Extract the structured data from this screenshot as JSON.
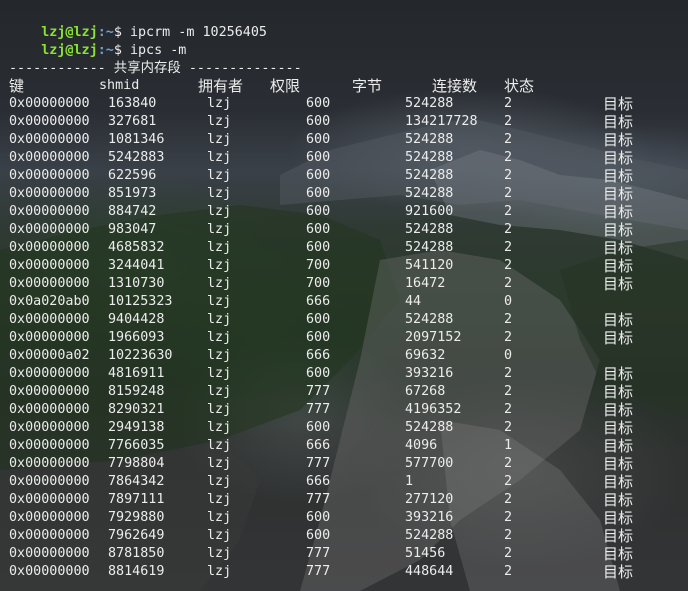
{
  "commands": [
    {
      "user": "lzj@lzj",
      "path": ":~",
      "symbol": "$ ",
      "text": "ipcrm -m 10256405"
    },
    {
      "user": "lzj@lzj",
      "path": ":~",
      "symbol": "$ ",
      "text": "ipcs -m"
    }
  ],
  "section_title": "------------ 共享内存段 --------------",
  "headers": {
    "key": "键",
    "shmid": "shmid",
    "owner": "拥有者",
    "perms": "权限",
    "bytes": "字节",
    "nattch": "连接数",
    "status": "状态"
  },
  "rows": [
    {
      "key": "0x00000000",
      "shmid": "163840",
      "owner": "lzj",
      "perms": "600",
      "bytes": "524288",
      "nattch": "2",
      "status": "目标"
    },
    {
      "key": "0x00000000",
      "shmid": "327681",
      "owner": "lzj",
      "perms": "600",
      "bytes": "134217728",
      "nattch": "2",
      "status": "目标"
    },
    {
      "key": "0x00000000",
      "shmid": "1081346",
      "owner": "lzj",
      "perms": "600",
      "bytes": "524288",
      "nattch": "2",
      "status": "目标"
    },
    {
      "key": "0x00000000",
      "shmid": "5242883",
      "owner": "lzj",
      "perms": "600",
      "bytes": "524288",
      "nattch": "2",
      "status": "目标"
    },
    {
      "key": "0x00000000",
      "shmid": "622596",
      "owner": "lzj",
      "perms": "600",
      "bytes": "524288",
      "nattch": "2",
      "status": "目标"
    },
    {
      "key": "0x00000000",
      "shmid": "851973",
      "owner": "lzj",
      "perms": "600",
      "bytes": "524288",
      "nattch": "2",
      "status": "目标"
    },
    {
      "key": "0x00000000",
      "shmid": "884742",
      "owner": "lzj",
      "perms": "600",
      "bytes": "921600",
      "nattch": "2",
      "status": "目标"
    },
    {
      "key": "0x00000000",
      "shmid": "983047",
      "owner": "lzj",
      "perms": "600",
      "bytes": "524288",
      "nattch": "2",
      "status": "目标"
    },
    {
      "key": "0x00000000",
      "shmid": "4685832",
      "owner": "lzj",
      "perms": "600",
      "bytes": "524288",
      "nattch": "2",
      "status": "目标"
    },
    {
      "key": "0x00000000",
      "shmid": "3244041",
      "owner": "lzj",
      "perms": "700",
      "bytes": "541120",
      "nattch": "2",
      "status": "目标"
    },
    {
      "key": "0x00000000",
      "shmid": "1310730",
      "owner": "lzj",
      "perms": "700",
      "bytes": "16472",
      "nattch": "2",
      "status": "目标"
    },
    {
      "key": "0x0a020ab0",
      "shmid": "10125323",
      "owner": "lzj",
      "perms": "666",
      "bytes": "44",
      "nattch": "0",
      "status": ""
    },
    {
      "key": "0x00000000",
      "shmid": "9404428",
      "owner": "lzj",
      "perms": "600",
      "bytes": "524288",
      "nattch": "2",
      "status": "目标"
    },
    {
      "key": "0x00000000",
      "shmid": "1966093",
      "owner": "lzj",
      "perms": "600",
      "bytes": "2097152",
      "nattch": "2",
      "status": "目标"
    },
    {
      "key": "0x00000a02",
      "shmid": "10223630",
      "owner": "lzj",
      "perms": "666",
      "bytes": "69632",
      "nattch": "0",
      "status": ""
    },
    {
      "key": "0x00000000",
      "shmid": "4816911",
      "owner": "lzj",
      "perms": "600",
      "bytes": "393216",
      "nattch": "2",
      "status": "目标"
    },
    {
      "key": "0x00000000",
      "shmid": "8159248",
      "owner": "lzj",
      "perms": "777",
      "bytes": "67268",
      "nattch": "2",
      "status": "目标"
    },
    {
      "key": "0x00000000",
      "shmid": "8290321",
      "owner": "lzj",
      "perms": "777",
      "bytes": "4196352",
      "nattch": "2",
      "status": "目标"
    },
    {
      "key": "0x00000000",
      "shmid": "2949138",
      "owner": "lzj",
      "perms": "600",
      "bytes": "524288",
      "nattch": "2",
      "status": "目标"
    },
    {
      "key": "0x00000000",
      "shmid": "7766035",
      "owner": "lzj",
      "perms": "666",
      "bytes": "4096",
      "nattch": "1",
      "status": "目标"
    },
    {
      "key": "0x00000000",
      "shmid": "7798804",
      "owner": "lzj",
      "perms": "777",
      "bytes": "577700",
      "nattch": "2",
      "status": "目标"
    },
    {
      "key": "0x00000000",
      "shmid": "7864342",
      "owner": "lzj",
      "perms": "666",
      "bytes": "1",
      "nattch": "2",
      "status": "目标"
    },
    {
      "key": "0x00000000",
      "shmid": "7897111",
      "owner": "lzj",
      "perms": "777",
      "bytes": "277120",
      "nattch": "2",
      "status": "目标"
    },
    {
      "key": "0x00000000",
      "shmid": "7929880",
      "owner": "lzj",
      "perms": "600",
      "bytes": "393216",
      "nattch": "2",
      "status": "目标"
    },
    {
      "key": "0x00000000",
      "shmid": "7962649",
      "owner": "lzj",
      "perms": "600",
      "bytes": "524288",
      "nattch": "2",
      "status": "目标"
    },
    {
      "key": "0x00000000",
      "shmid": "8781850",
      "owner": "lzj",
      "perms": "777",
      "bytes": "51456",
      "nattch": "2",
      "status": "目标"
    },
    {
      "key": "0x00000000",
      "shmid": "8814619",
      "owner": "lzj",
      "perms": "777",
      "bytes": "448644",
      "nattch": "2",
      "status": "目标"
    }
  ],
  "colors": {
    "prompt_user": "#8ae234",
    "prompt_path": "#729fcf",
    "text": "#ececec"
  }
}
